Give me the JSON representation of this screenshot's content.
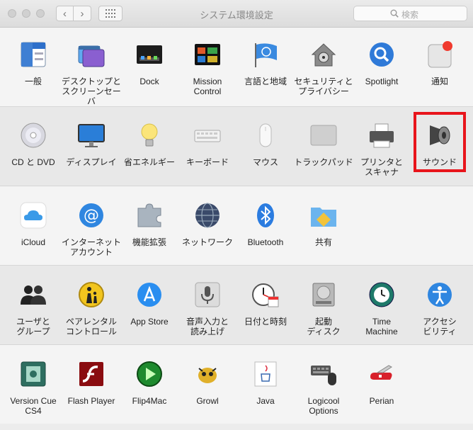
{
  "window": {
    "title": "システム環境設定",
    "search_placeholder": "検索"
  },
  "sections": [
    {
      "panes": [
        {
          "label": "一般"
        },
        {
          "label": "デスクトップと\nスクリーンセーバ"
        },
        {
          "label": "Dock"
        },
        {
          "label": "Mission\nControl"
        },
        {
          "label": "言語と地域"
        },
        {
          "label": "セキュリティと\nプライバシー"
        },
        {
          "label": "Spotlight"
        },
        {
          "label": "通知"
        }
      ]
    },
    {
      "panes": [
        {
          "label": "CD と DVD"
        },
        {
          "label": "ディスプレイ"
        },
        {
          "label": "省エネルギー"
        },
        {
          "label": "キーボード"
        },
        {
          "label": "マウス"
        },
        {
          "label": "トラックパッド"
        },
        {
          "label": "プリンタと\nスキャナ"
        },
        {
          "label": "サウンド"
        }
      ]
    },
    {
      "panes": [
        {
          "label": "iCloud"
        },
        {
          "label": "インターネット\nアカウント"
        },
        {
          "label": "機能拡張"
        },
        {
          "label": "ネットワーク"
        },
        {
          "label": "Bluetooth"
        },
        {
          "label": "共有"
        }
      ]
    },
    {
      "panes": [
        {
          "label": "ユーザと\nグループ"
        },
        {
          "label": "ペアレンタル\nコントロール"
        },
        {
          "label": "App Store"
        },
        {
          "label": "音声入力と\n読み上げ"
        },
        {
          "label": "日付と時刻"
        },
        {
          "label": "起動\nディスク"
        },
        {
          "label": "Time\nMachine"
        },
        {
          "label": "アクセシ\nビリティ"
        }
      ]
    },
    {
      "panes": [
        {
          "label": "Version Cue\nCS4"
        },
        {
          "label": "Flash Player"
        },
        {
          "label": "Flip4Mac"
        },
        {
          "label": "Growl"
        },
        {
          "label": "Java"
        },
        {
          "label": "Logicool Options"
        },
        {
          "label": "Perian"
        }
      ]
    }
  ],
  "colors": {
    "highlight": "#e8141b"
  }
}
